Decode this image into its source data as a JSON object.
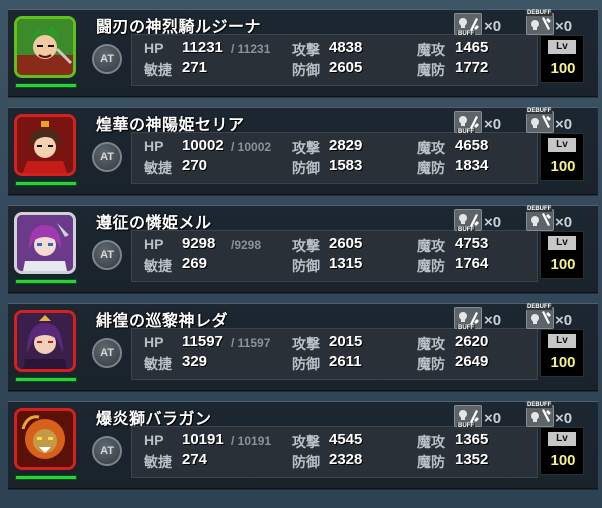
{
  "labels": {
    "hp": "HP",
    "agi": "敏捷",
    "atk": "攻撃",
    "def": "防御",
    "matk": "魔攻",
    "mdef": "魔防",
    "at": "AT",
    "lv": "Lv",
    "buff": "BUFF",
    "debuff": "DEBUFF"
  },
  "units": [
    {
      "name": "闘刃の神烈騎ルジーナ",
      "hp": "11231",
      "hp_max": "/ 11231",
      "atk": "4838",
      "matk": "1465",
      "agi": "271",
      "def": "2605",
      "mdef": "1772",
      "level": "100",
      "buff": "×0",
      "debuff": "×0",
      "hp_fraction": 1.0,
      "frame_color": "#5ec21a",
      "portrait": "green-warrior-portrait"
    },
    {
      "name": "煌華の神陽姫セリア",
      "hp": "10002",
      "hp_max": "/ 10002",
      "atk": "2829",
      "matk": "4658",
      "agi": "270",
      "def": "1583",
      "mdef": "1834",
      "level": "100",
      "buff": "×0",
      "debuff": "×0",
      "hp_fraction": 1.0,
      "frame_color": "#d4211e",
      "portrait": "red-princess-portrait"
    },
    {
      "name": "遵征の憐姫メル",
      "hp": "9298",
      "hp_max": "/9298",
      "atk": "2605",
      "matk": "4753",
      "agi": "269",
      "def": "1315",
      "mdef": "1764",
      "level": "100",
      "buff": "×0",
      "debuff": "×0",
      "hp_fraction": 1.0,
      "frame_color": "#cfd3d6",
      "portrait": "purple-mage-portrait"
    },
    {
      "name": "緋徨の巡黎神レダ",
      "hp": "11597",
      "hp_max": "/ 11597",
      "atk": "2015",
      "matk": "2620",
      "agi": "329",
      "def": "2611",
      "mdef": "2649",
      "level": "100",
      "buff": "×0",
      "debuff": "×0",
      "hp_fraction": 1.0,
      "frame_color": "#d4211e",
      "portrait": "dark-huntress-portrait"
    },
    {
      "name": "爆炎獅バラガン",
      "hp": "10191",
      "hp_max": "/ 10191",
      "atk": "4545",
      "matk": "1365",
      "agi": "274",
      "def": "2328",
      "mdef": "1352",
      "level": "100",
      "buff": "×0",
      "debuff": "×0",
      "hp_fraction": 1.0,
      "frame_color": "#d4211e",
      "portrait": "fire-lion-portrait"
    }
  ]
}
